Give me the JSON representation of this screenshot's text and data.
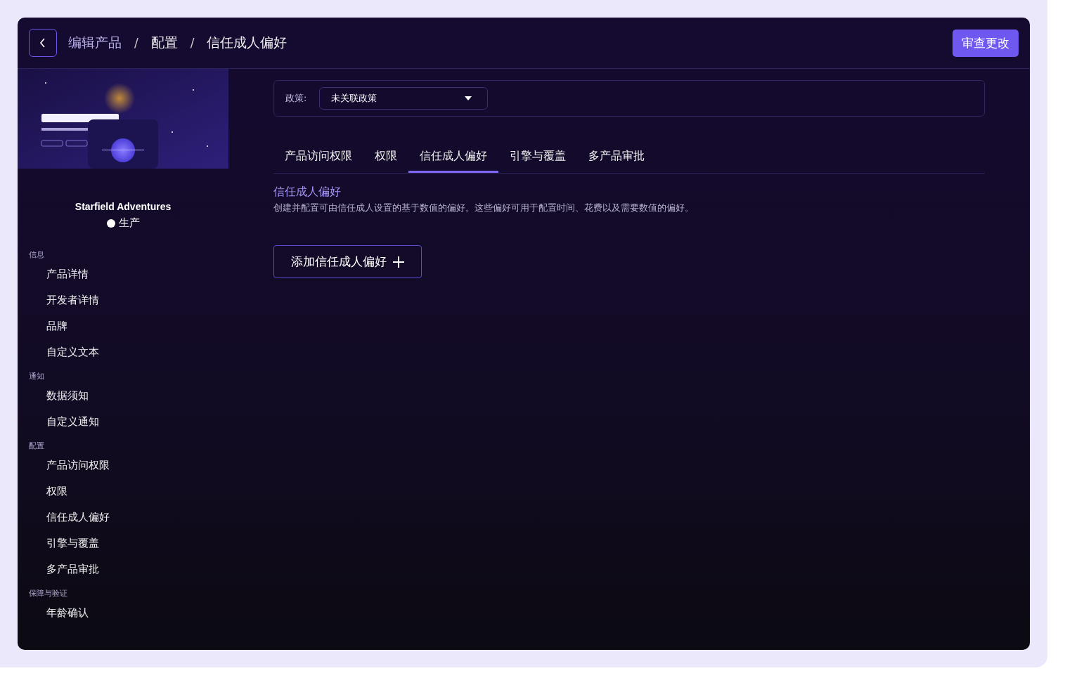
{
  "breadcrumb": [
    {
      "label": "编辑产品",
      "kind": "link"
    },
    {
      "label": "配置",
      "kind": "current"
    },
    {
      "label": "信任成人偏好",
      "kind": "current"
    }
  ],
  "breadcrumb_separator": "/",
  "review_button": "审查更改",
  "product": {
    "name": "Starfield Adventures",
    "status": {
      "label": "生产",
      "color": "#ffffff"
    }
  },
  "sidebar": [
    {
      "label": "信息",
      "items": [
        "产品详情",
        "开发者详情",
        "品牌",
        "自定义文本"
      ]
    },
    {
      "label": "通知",
      "items": [
        "数据须知",
        "自定义通知"
      ]
    },
    {
      "label": "配置",
      "items": [
        "产品访问权限",
        "权限",
        "信任成人偏好",
        "引擎与覆盖",
        "多产品审批"
      ]
    },
    {
      "label": "保障与验证",
      "items": [
        "年龄确认"
      ]
    }
  ],
  "policy": {
    "label": "政策:",
    "value": "未关联政策"
  },
  "tabs": [
    {
      "label": "产品访问权限",
      "selected": false
    },
    {
      "label": "权限",
      "selected": false
    },
    {
      "label": "信任成人偏好",
      "selected": true
    },
    {
      "label": "引擎与覆盖",
      "selected": false
    },
    {
      "label": "多产品审批",
      "selected": false
    }
  ],
  "section": {
    "title": "信任成人偏好",
    "description": "创建并配置可由信任成人设置的基于数值的偏好。这些偏好可用于配置时间、花费以及需要数值的偏好。"
  },
  "add_button": "添加信任成人偏好"
}
